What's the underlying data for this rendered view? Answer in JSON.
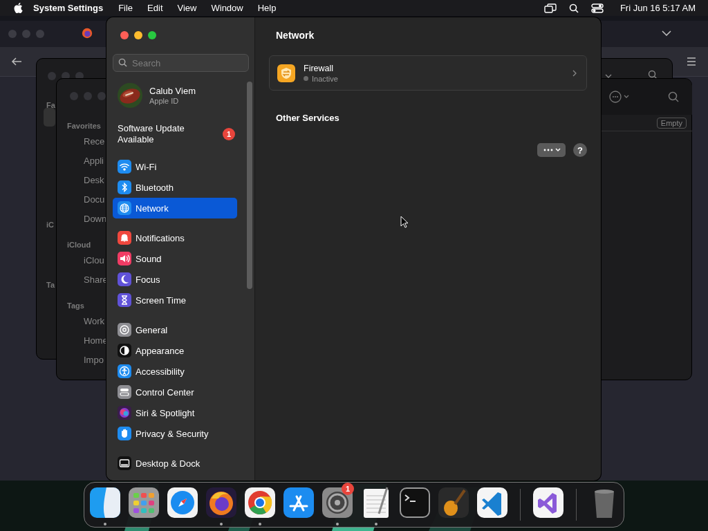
{
  "menu_bar": {
    "app_name": "System Settings",
    "menus": [
      "File",
      "Edit",
      "View",
      "Window",
      "Help"
    ],
    "clock": "Fri Jun 16  5:17 AM"
  },
  "finder_back": {
    "sidebar": [
      "Fa",
      "iC",
      "Ta"
    ]
  },
  "finder_front": {
    "sections": [
      {
        "title": "Favorites",
        "items": [
          "Rece",
          "Appli",
          "Desk",
          "Docu",
          "Down"
        ]
      },
      {
        "title": "iCloud",
        "items": [
          "iClou",
          "Share"
        ]
      },
      {
        "title": "Tags",
        "items": [
          "Work",
          "Home",
          "Impo"
        ]
      }
    ],
    "badge": "Empty"
  },
  "settings": {
    "search": {
      "placeholder": "Search"
    },
    "account": {
      "name": "Calub Viem",
      "subtitle": "Apple ID"
    },
    "update": {
      "label": "Software Update Available",
      "badge": "1"
    },
    "groups": [
      {
        "items": [
          {
            "label": "Wi-Fi",
            "kind": "wifi",
            "selected": false
          },
          {
            "label": "Bluetooth",
            "kind": "bluetooth",
            "selected": false
          },
          {
            "label": "Network",
            "kind": "network",
            "selected": true
          }
        ]
      },
      {
        "items": [
          {
            "label": "Notifications",
            "kind": "notifications",
            "selected": false
          },
          {
            "label": "Sound",
            "kind": "sound",
            "selected": false
          },
          {
            "label": "Focus",
            "kind": "focus",
            "selected": false
          },
          {
            "label": "Screen Time",
            "kind": "screentime",
            "selected": false
          }
        ]
      },
      {
        "items": [
          {
            "label": "General",
            "kind": "general",
            "selected": false
          },
          {
            "label": "Appearance",
            "kind": "appearance",
            "selected": false
          },
          {
            "label": "Accessibility",
            "kind": "accessibility",
            "selected": false
          },
          {
            "label": "Control Center",
            "kind": "controlcenter",
            "selected": false
          },
          {
            "label": "Siri & Spotlight",
            "kind": "siri",
            "selected": false
          },
          {
            "label": "Privacy & Security",
            "kind": "privacy",
            "selected": false
          }
        ]
      },
      {
        "items": [
          {
            "label": "Desktop & Dock",
            "kind": "desktop",
            "selected": false
          }
        ]
      }
    ],
    "page_title": "Network",
    "firewall": {
      "title": "Firewall",
      "status": "Inactive",
      "active": false
    },
    "other_services": "Other Services",
    "help": "?"
  },
  "dock": {
    "sections": [
      {
        "apps": [
          {
            "kind": "finder",
            "running": true
          },
          {
            "kind": "launchpad",
            "running": false
          },
          {
            "kind": "safari",
            "running": false
          },
          {
            "kind": "firefox",
            "running": true
          },
          {
            "kind": "chrome",
            "running": true
          },
          {
            "kind": "appstore",
            "running": false
          },
          {
            "kind": "settings",
            "running": true,
            "badge": "1"
          },
          {
            "kind": "textedit",
            "running": true
          },
          {
            "kind": "terminal",
            "running": false
          },
          {
            "kind": "garageband",
            "running": false
          },
          {
            "kind": "vscode",
            "running": false
          }
        ]
      },
      {
        "apps": [
          {
            "kind": "visualstudio",
            "running": false
          }
        ]
      },
      {
        "apps": [
          {
            "kind": "trash",
            "running": false
          }
        ]
      }
    ]
  }
}
